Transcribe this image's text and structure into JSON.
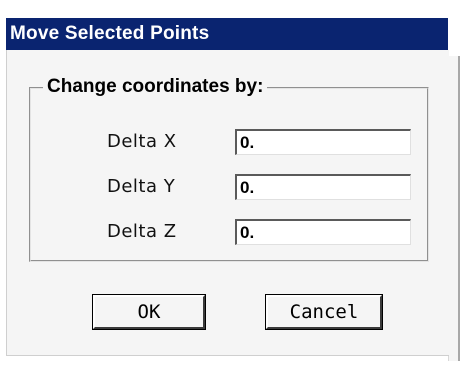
{
  "window": {
    "title": "Move Selected Points"
  },
  "group": {
    "legend": "Change coordinates by:"
  },
  "fields": [
    {
      "label": "Delta X",
      "value": "0."
    },
    {
      "label": "Delta Y",
      "value": "0."
    },
    {
      "label": "Delta Z",
      "value": "0."
    }
  ],
  "buttons": {
    "ok_label": "OK",
    "cancel_label": "Cancel"
  },
  "colors": {
    "titlebar": "#0a2470",
    "dialog_bg": "#f5f5f5"
  }
}
